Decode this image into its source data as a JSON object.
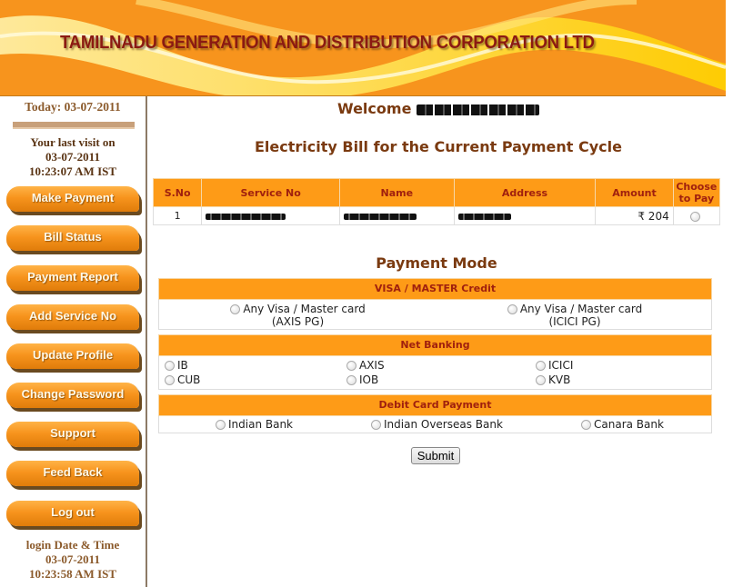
{
  "header": {
    "title": "TAMILNADU GENERATION AND DISTRIBUTION CORPORATION LTD"
  },
  "sidebar": {
    "today": "Today: 03-07-2011",
    "last_visit": {
      "label": "Your last visit on",
      "date": "03-07-2011",
      "time": "10:23:07 AM IST"
    },
    "nav": [
      {
        "label": "Make Payment"
      },
      {
        "label": "Bill Status"
      },
      {
        "label": "Payment Report"
      },
      {
        "label": "Add Service No"
      },
      {
        "label": "Update Profile"
      },
      {
        "label": "Change Password"
      },
      {
        "label": "Support"
      },
      {
        "label": "Feed Back"
      },
      {
        "label": "Log out"
      }
    ],
    "login": {
      "label": "login Date & Time",
      "date": "03-07-2011",
      "time": "10:23:58 AM IST"
    }
  },
  "main": {
    "welcome_label": "Welcome",
    "bill_title": "Electricity Bill for the Current Payment Cycle",
    "bill_table": {
      "headers": [
        "S.No",
        "Service No",
        "Name",
        "Address",
        "Amount",
        "Choose to Pay"
      ],
      "rows": [
        {
          "sno": "1",
          "service_no": "[redacted]",
          "name": "[redacted]",
          "address": "[redacted]",
          "amount": "₹ 204"
        }
      ]
    },
    "payment_mode": {
      "title": "Payment Mode",
      "credit": {
        "heading": "VISA / MASTER Credit",
        "options": [
          {
            "line1": "Any Visa / Master card",
            "line2": "(AXIS PG)"
          },
          {
            "line1": "Any Visa / Master card",
            "line2": "(ICICI PG)"
          }
        ]
      },
      "net_banking": {
        "heading": "Net Banking",
        "options": [
          "IB",
          "AXIS",
          "ICICI",
          "CUB",
          "IOB",
          "KVB"
        ]
      },
      "debit": {
        "heading": "Debit Card Payment",
        "options": [
          "Indian Bank",
          "Indian Overseas Bank",
          "Canara Bank"
        ]
      }
    },
    "submit_label": "Submit"
  }
}
